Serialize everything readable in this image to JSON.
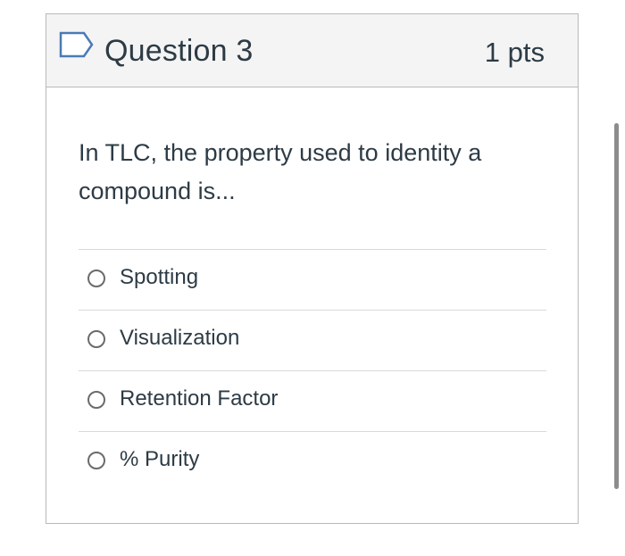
{
  "question": {
    "title": "Question 3",
    "points": "1 pts",
    "text": "In TLC, the property used to identity a compound is...",
    "flag_icon": "flag-outline-icon"
  },
  "answers": [
    {
      "label": "Spotting",
      "selected": false
    },
    {
      "label": "Visualization",
      "selected": false
    },
    {
      "label": "Retention Factor",
      "selected": false
    },
    {
      "label": "% Purity",
      "selected": false
    }
  ],
  "colors": {
    "text": "#2d3b45",
    "header_bg": "#f4f4f4",
    "border": "#b9b9b9",
    "flag": "#4a7ab5"
  }
}
